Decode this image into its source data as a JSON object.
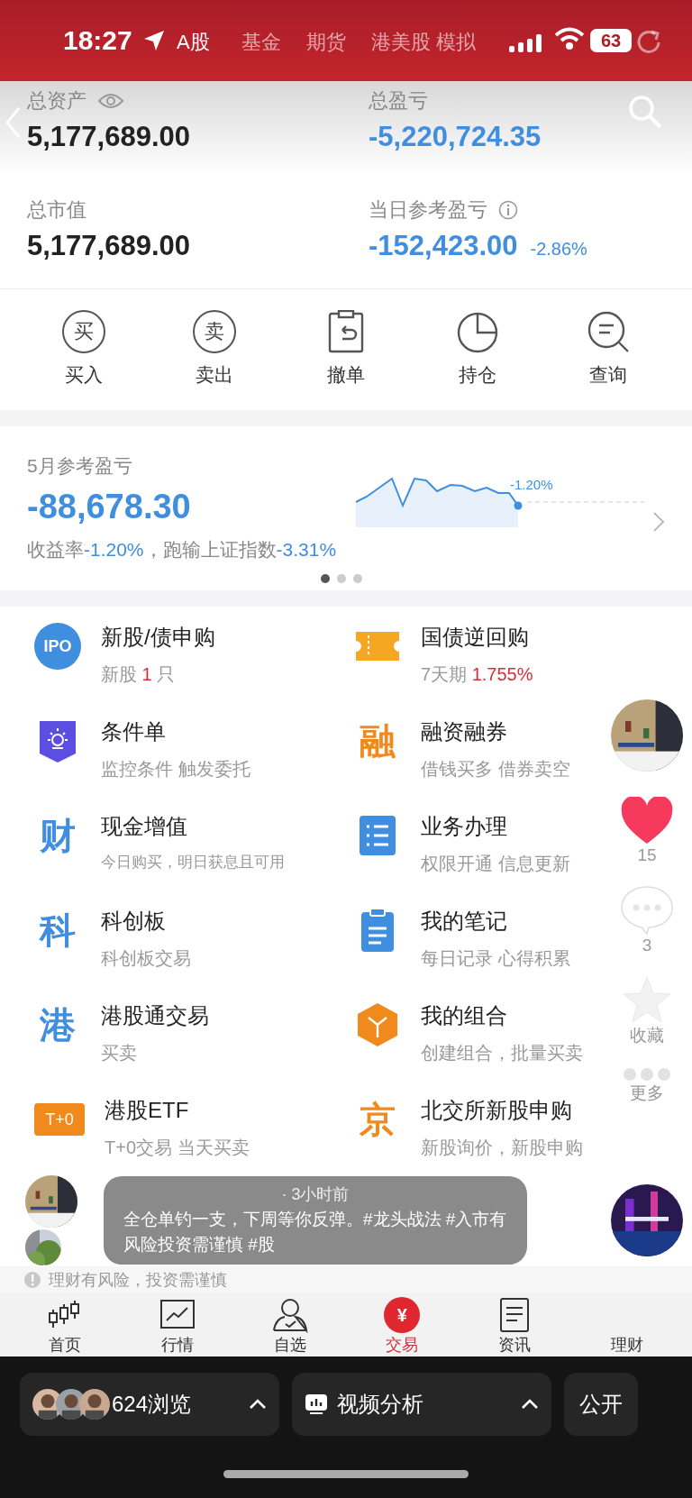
{
  "status_bar": {
    "time": "18:27",
    "battery": "63"
  },
  "market_tabs": [
    {
      "label": "A股",
      "selected": true
    },
    {
      "label": "基金",
      "selected": false
    },
    {
      "label": "期货",
      "selected": false
    },
    {
      "label": "港美股",
      "selected": false
    },
    {
      "label": "模拟",
      "selected": false
    }
  ],
  "summary": [
    {
      "label": "总资产",
      "kind": "eye",
      "value": "5,177,689.00",
      "negative": false
    },
    {
      "label": "总盈亏",
      "kind": "plain",
      "value": "-5,220,724.35",
      "negative": true
    },
    {
      "label": "总市值",
      "kind": "plain",
      "value": "5,177,689.00",
      "negative": false
    },
    {
      "label": "当日参考盈亏",
      "kind": "info",
      "value": "-152,423.00",
      "negative": true,
      "change": "-2.86%"
    }
  ],
  "actions": [
    {
      "label": "买入",
      "kind": "glyph",
      "glyph": "买"
    },
    {
      "label": "卖出",
      "kind": "glyph",
      "glyph": "卖"
    },
    {
      "label": "撤单",
      "kind": "cancel"
    },
    {
      "label": "持仓",
      "kind": "pie"
    },
    {
      "label": "查询",
      "kind": "query"
    }
  ],
  "monthly": {
    "title": "5月参考盈亏",
    "value": "-88,678.30",
    "chart_label": "-1.20%",
    "summary": [
      {
        "text": "收益率",
        "kind": "label"
      },
      {
        "text": "-1.20%",
        "kind": "value"
      },
      {
        "text": "，跑输上证指数",
        "kind": "label"
      },
      {
        "text": "-3.31%",
        "kind": "value"
      }
    ],
    "pages": [
      {
        "selected": true
      },
      {
        "selected": false
      },
      {
        "selected": false
      }
    ]
  },
  "services": [
    {
      "title": "新股/债申购",
      "kind": "ipo",
      "glyph": "IPO",
      "subtitle": [
        {
          "text": "新股 ",
          "kind": "label"
        },
        {
          "text": "1",
          "kind": "alert"
        },
        {
          "text": " 只",
          "kind": "label"
        }
      ]
    },
    {
      "title": "国债逆回购",
      "kind": "ticket",
      "subtitle": [
        {
          "text": "7天期 ",
          "kind": "label"
        },
        {
          "text": "1.755%",
          "kind": "alert"
        }
      ]
    },
    {
      "title": "条件单",
      "kind": "lamp",
      "subtitle": [
        {
          "text": "监控条件 触发委托",
          "kind": "label"
        }
      ]
    },
    {
      "title": "融资融券",
      "kind": "glyph",
      "color": "#f08a1c",
      "glyph": "融",
      "subtitle": [
        {
          "text": "借钱买多 借券卖空",
          "kind": "label"
        }
      ]
    },
    {
      "title": "现金增值",
      "kind": "glyph",
      "color": "#3f8ee0",
      "glyph": "财",
      "subtitle": [
        {
          "text": "今日购买，明日获息且可用",
          "kind": "small"
        }
      ]
    },
    {
      "title": "业务办理",
      "kind": "list",
      "subtitle": [
        {
          "text": "权限开通 信息更新",
          "kind": "label"
        }
      ]
    },
    {
      "title": "科创板",
      "kind": "glyph",
      "color": "#3f8ee0",
      "glyph": "科",
      "subtitle": [
        {
          "text": "科创板交易",
          "kind": "label"
        }
      ]
    },
    {
      "title": "我的笔记",
      "kind": "clipboard",
      "subtitle": [
        {
          "text": "每日记录 心得积累",
          "kind": "label"
        }
      ]
    },
    {
      "title": "港股通交易",
      "kind": "glyph",
      "color": "#3f8ee0",
      "glyph": "港",
      "subtitle": [
        {
          "text": "买卖",
          "kind": "label"
        }
      ]
    },
    {
      "title": "我的组合",
      "kind": "cube",
      "subtitle": [
        {
          "text": "创建组合，批量买卖",
          "kind": "label"
        }
      ]
    },
    {
      "title": "港股ETF",
      "kind": "badge",
      "glyph": "T+0",
      "subtitle": [
        {
          "text": "T+0交易 当天买卖",
          "kind": "label"
        }
      ]
    },
    {
      "title": "北交所新股申购",
      "kind": "glyph",
      "color": "#f08a1c",
      "glyph": "京",
      "subtitle": [
        {
          "text": "新股询价，新股申购",
          "kind": "label"
        }
      ]
    }
  ],
  "bottom_nav": [
    {
      "label": "首页",
      "kind": "candles",
      "selected": false
    },
    {
      "label": "行情",
      "kind": "chart",
      "selected": false
    },
    {
      "label": "自选",
      "kind": "person",
      "selected": false
    },
    {
      "label": "交易",
      "kind": "coin",
      "glyph": "¥",
      "selected": true
    },
    {
      "label": "资讯",
      "kind": "doc",
      "selected": false
    },
    {
      "label": "理财",
      "kind": "none",
      "selected": false
    }
  ],
  "disclaimer": "理财有风险，投资需谨慎",
  "video_overlay": {
    "meta": "· 3小时前",
    "caption": "全仓单钓一支，下周等你反弹。#龙头战法 #入市有风险投资需谨慎 #股",
    "liked": true,
    "likes": "15",
    "comments": "3",
    "favorite_label": "收藏",
    "more_label": "更多"
  },
  "video_bar": {
    "views": "624浏览",
    "analysis": "视频分析",
    "publish": "公开"
  }
}
